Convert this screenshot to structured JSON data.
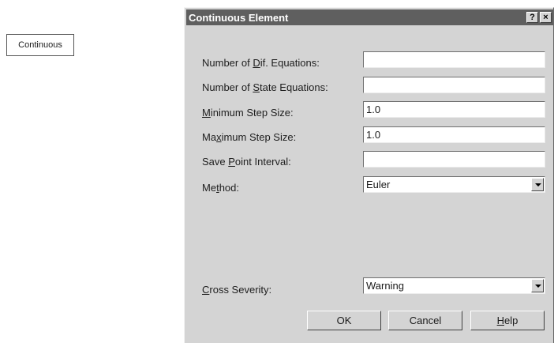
{
  "canvas_element": {
    "label": "Continuous"
  },
  "dialog": {
    "title": "Continuous Element",
    "help_button": "?",
    "close_button": "×",
    "fields": [
      {
        "label_pre": "Number of ",
        "label_key": "D",
        "label_post": "if. Equations:",
        "value": ""
      },
      {
        "label_pre": "Number of ",
        "label_key": "S",
        "label_post": "tate Equations:",
        "value": ""
      },
      {
        "label_pre": "",
        "label_key": "M",
        "label_post": "inimum Step Size:",
        "value": "1.0"
      },
      {
        "label_pre": "Ma",
        "label_key": "x",
        "label_post": "imum Step Size:",
        "value": "1.0"
      },
      {
        "label_pre": "Save ",
        "label_key": "P",
        "label_post": "oint Interval:",
        "value": ""
      }
    ],
    "method": {
      "label_pre": "Me",
      "label_key": "t",
      "label_post": "hod:",
      "value": "Euler"
    },
    "cross_severity": {
      "label_pre": "",
      "label_key": "C",
      "label_post": "ross Severity:",
      "value": "Warning"
    },
    "buttons": {
      "ok": "OK",
      "cancel": "Cancel",
      "help_key": "H",
      "help_rest": "elp"
    }
  }
}
